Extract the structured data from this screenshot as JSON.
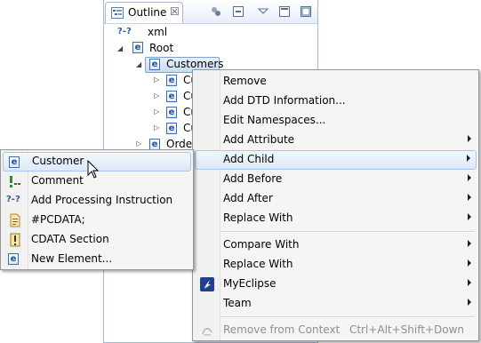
{
  "outline_view": {
    "tab_title": "Outline",
    "close_glyph": "☒",
    "tree": [
      {
        "label": "xml",
        "icon": "processing-instruction"
      },
      {
        "label": "Root",
        "icon": "element"
      },
      {
        "label": "Customers",
        "icon": "element"
      },
      {
        "label": "Cu",
        "icon": "element"
      },
      {
        "label": "Cu",
        "icon": "element"
      },
      {
        "label": "Cu",
        "icon": "element"
      },
      {
        "label": "Cu",
        "icon": "element"
      },
      {
        "label": "Order",
        "icon": "element"
      }
    ]
  },
  "context_menu": {
    "items": [
      {
        "label": "Remove"
      },
      {
        "label": "Add DTD Information..."
      },
      {
        "label": "Edit Namespaces..."
      },
      {
        "label": "Add Attribute",
        "submenu": true
      },
      {
        "label": "Add Child",
        "submenu": true,
        "highlighted": true
      },
      {
        "label": "Add Before",
        "submenu": true
      },
      {
        "label": "Add After",
        "submenu": true
      },
      {
        "label": "Replace With",
        "submenu": true
      },
      {
        "label": "Compare With",
        "submenu": true
      },
      {
        "label": "Replace With",
        "submenu": true
      },
      {
        "label": "MyEclipse",
        "submenu": true,
        "icon": "myeclipse-icon"
      },
      {
        "label": "Team",
        "submenu": true
      },
      {
        "label": "Remove from Context",
        "accelerator": "Ctrl+Alt+Shift+Down",
        "disabled": true,
        "icon": "remove-context-icon"
      }
    ]
  },
  "add_child_submenu": {
    "items": [
      {
        "label": "Customer",
        "icon": "element-icon",
        "highlighted": true
      },
      {
        "label": "Comment",
        "icon": "comment-icon"
      },
      {
        "label": "Add Processing Instruction",
        "icon": "processing-instruction-icon"
      },
      {
        "label": "#PCDATA;",
        "icon": "pcdata-icon"
      },
      {
        "label": "CDATA Section",
        "icon": "cdata-icon"
      },
      {
        "label": "New Element...",
        "icon": "element-icon"
      }
    ]
  },
  "glyphs": {
    "element": "e",
    "pi": "?-?"
  },
  "colors": {
    "highlight_border": "#a8c7ec",
    "view_border": "#a9b9cf",
    "element_icon": "#3a6fb0"
  }
}
